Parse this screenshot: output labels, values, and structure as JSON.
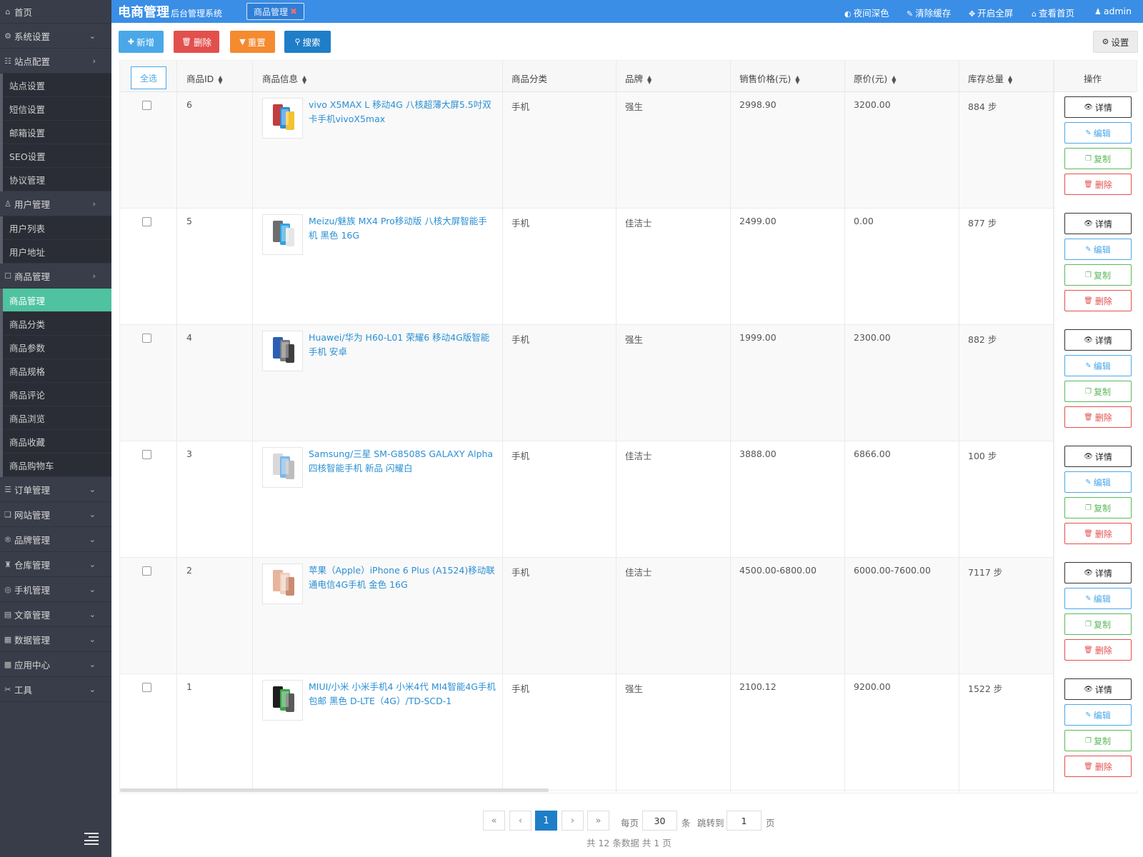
{
  "sidebar": {
    "home": "首页",
    "groups": [
      {
        "label": "系统设置",
        "icon": "gear-icon",
        "glyph": "⚙",
        "chevron": "⌄"
      },
      {
        "label": "站点配置",
        "icon": "sliders-icon",
        "glyph": "☷",
        "chevron": "›"
      },
      {
        "label": "用户管理",
        "icon": "user-icon",
        "glyph": "♙",
        "chevron": "›"
      },
      {
        "label": "商品管理",
        "icon": "box-icon",
        "glyph": "☐",
        "chevron": "›"
      },
      {
        "label": "订单管理",
        "icon": "list-icon",
        "glyph": "☰",
        "chevron": "⌄"
      },
      {
        "label": "网站管理",
        "icon": "web-icon",
        "glyph": "❏",
        "chevron": "⌄"
      },
      {
        "label": "品牌管理",
        "icon": "brand-icon",
        "glyph": "®",
        "chevron": "⌄"
      },
      {
        "label": "仓库管理",
        "icon": "warehouse-icon",
        "glyph": "♜",
        "chevron": "⌄"
      },
      {
        "label": "手机管理",
        "icon": "phone-icon",
        "glyph": "◎",
        "chevron": "⌄"
      },
      {
        "label": "文章管理",
        "icon": "article-icon",
        "glyph": "▤",
        "chevron": "⌄"
      },
      {
        "label": "数据管理",
        "icon": "database-icon",
        "glyph": "▦",
        "chevron": "⌄"
      },
      {
        "label": "应用中心",
        "icon": "apps-icon",
        "glyph": "▩",
        "chevron": "⌄"
      },
      {
        "label": "工具",
        "icon": "tools-icon",
        "glyph": "✂",
        "chevron": "⌄"
      }
    ],
    "site_sub": [
      "站点设置",
      "短信设置",
      "邮箱设置",
      "SEO设置",
      "协议管理"
    ],
    "user_sub": [
      "用户列表",
      "用户地址"
    ],
    "goods_sub": [
      "商品管理",
      "商品分类",
      "商品参数",
      "商品规格",
      "商品评论",
      "商品浏览",
      "商品收藏",
      "商品购物车"
    ]
  },
  "header": {
    "logo": "电商管理",
    "logo_sub": "后台管理系统",
    "open_tab": "商品管理",
    "close_glyph": "✖",
    "links": [
      "夜间深色",
      "清除缓存",
      "开启全屏",
      "查看首页",
      "admin"
    ]
  },
  "toolbar": {
    "add": "新增",
    "delete": "删除",
    "reset": "重置",
    "search": "搜索",
    "settings": "设置"
  },
  "table": {
    "select_all": "全选",
    "columns": {
      "id": "商品ID",
      "info": "商品信息",
      "category": "商品分类",
      "brand": "品牌",
      "price": "销售价格(元)",
      "original": "原价(元)",
      "stock": "库存总量",
      "ops": "操作"
    },
    "rows": [
      {
        "id": "6",
        "name": "vivo X5MAX L 移动4G 八核超薄大屏5.5吋双卡手机vivoX5max",
        "category": "手机",
        "brand": "强生",
        "price": "2998.90",
        "original": "3200.00",
        "stock": "884 步"
      },
      {
        "id": "5",
        "name": "Meizu/魅族 MX4 Pro移动版 八核大屏智能手机 黑色 16G",
        "category": "手机",
        "brand": "佳洁士",
        "price": "2499.00",
        "original": "0.00",
        "stock": "877 步"
      },
      {
        "id": "4",
        "name": "Huawei/华为 H60-L01 荣耀6 移动4G版智能手机 安卓",
        "category": "手机",
        "brand": "强生",
        "price": "1999.00",
        "original": "2300.00",
        "stock": "882 步"
      },
      {
        "id": "3",
        "name": "Samsung/三星 SM-G8508S GALAXY Alpha四核智能手机 新品 闪耀白",
        "category": "手机",
        "brand": "佳洁士",
        "price": "3888.00",
        "original": "6866.00",
        "stock": "100 步"
      },
      {
        "id": "2",
        "name": "苹果（Apple）iPhone 6 Plus (A1524)移动联通电信4G手机 金色 16G",
        "category": "手机",
        "brand": "佳洁士",
        "price": "4500.00-6800.00",
        "original": "6000.00-7600.00",
        "stock": "7117 步"
      },
      {
        "id": "1",
        "name": "MIUI/小米 小米手机4 小米4代 MI4智能4G手机包邮 黑色 D-LTE（4G）/TD-SCD-1",
        "category": "手机",
        "brand": "强生",
        "price": "2100.12",
        "original": "9200.00",
        "stock": "1522 步"
      }
    ],
    "ops": {
      "detail": "详情",
      "edit": "编辑",
      "copy": "复制",
      "delete": "删除"
    }
  },
  "pagination": {
    "first": "«",
    "prev": "‹",
    "current": "1",
    "next": "›",
    "last": "»",
    "per_page_label": "每页",
    "per_page_value": "30",
    "per_page_unit": "条",
    "jump_label": "跳转到",
    "jump_value": "1",
    "jump_unit": "页",
    "summary": "共 12 条数据   共 1 页"
  }
}
